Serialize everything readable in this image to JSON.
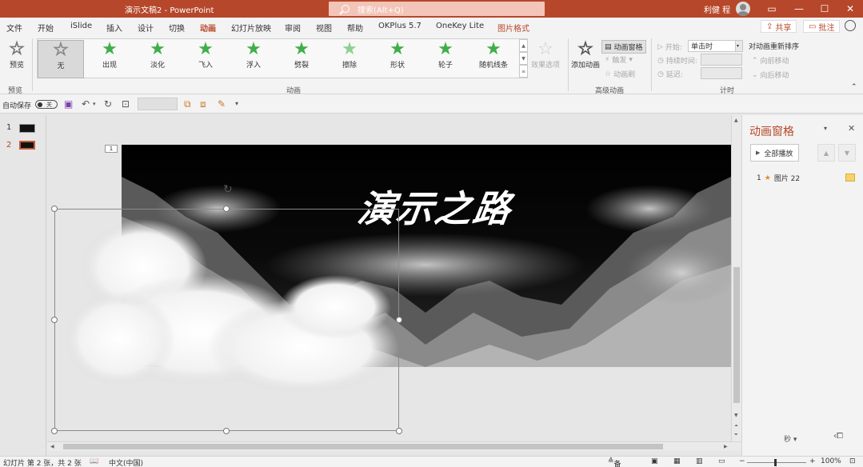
{
  "window": {
    "title": "演示文稿2  -  PowerPoint",
    "search_placeholder": "搜索(Alt+Q)",
    "user": "利健 程"
  },
  "tabs": [
    "文件",
    "开始",
    "iSlide",
    "插入",
    "设计",
    "切换",
    "动画",
    "幻灯片放映",
    "审阅",
    "视图",
    "帮助",
    "OKPlus 5.7",
    "OneKey Lite",
    "图片格式"
  ],
  "active_tab": "动画",
  "share_label": "共享",
  "comment_label": "批注",
  "ribbon": {
    "preview_label": "预览",
    "preview_group": "预览",
    "animations": [
      "无",
      "出现",
      "淡化",
      "飞入",
      "浮入",
      "劈裂",
      "擦除",
      "形状",
      "轮子",
      "随机线条"
    ],
    "effect_options": "效果选项",
    "anim_group": "动画",
    "add_animation": "添加动画",
    "anim_pane_btn": "动画窗格",
    "trigger": "触发",
    "anim_painter": "动画刷",
    "advanced_group": "高级动画",
    "start_label": "开始:",
    "start_value": "单击时",
    "duration_label": "持续时间:",
    "delay_label": "延迟:",
    "timing_group": "计时",
    "reorder_title": "对动画重新排序",
    "move_earlier": "向前移动",
    "move_later": "向后移动"
  },
  "qat": {
    "autosave": "自动保存",
    "autosave_state": "关"
  },
  "thumbnails": [
    {
      "num": "1"
    },
    {
      "num": "2"
    }
  ],
  "slide": {
    "number_tag": "1",
    "headline": "演示之路"
  },
  "pane": {
    "title": "动画窗格",
    "play_all": "全部播放",
    "item_index": "1",
    "item_label": "图片 22",
    "seconds_label": "秒"
  },
  "status": {
    "slide_info": "幻灯片 第 2 张，共 2 张",
    "language": "中文(中国)",
    "notes": "备注",
    "zoom": "100%"
  }
}
